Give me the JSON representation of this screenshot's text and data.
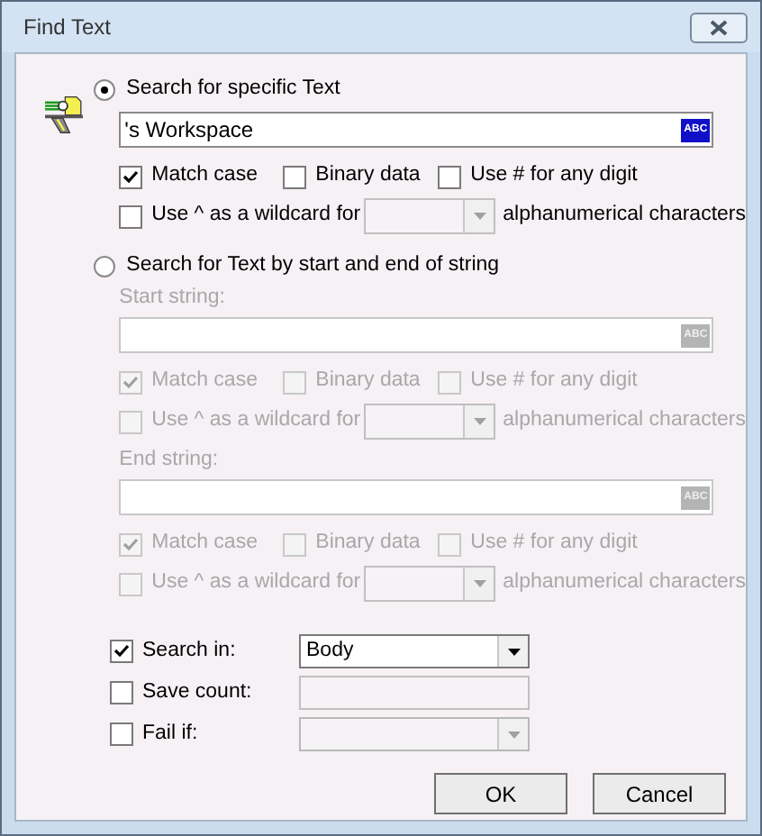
{
  "window": {
    "title": "Find Text"
  },
  "search_specific": {
    "label": "Search for specific Text",
    "selected": true,
    "field": {
      "value": "'s Workspace",
      "button": "ABC",
      "disabled": false
    },
    "options": [
      {
        "label": "Match case",
        "checked": true,
        "disabled": false
      },
      {
        "label": "Binary data",
        "checked": false,
        "disabled": false
      },
      {
        "label": "Use # for any digit",
        "checked": false,
        "disabled": false
      }
    ],
    "wildcard": {
      "label": "Use ^ as a wildcard for",
      "suffix": "alphanumerical characters",
      "checked": false,
      "disabled": false
    }
  },
  "search_by_range": {
    "label": "Search for Text by start and end of string",
    "selected": false,
    "strings": [
      {
        "label": "Start string:",
        "field": {
          "button": "ABC",
          "disabled": true
        },
        "options": [
          {
            "label": "Match case",
            "checked": true,
            "disabled": true
          },
          {
            "label": "Binary data",
            "checked": false,
            "disabled": true
          },
          {
            "label": "Use # for any digit",
            "checked": false,
            "disabled": true
          }
        ],
        "wildcard": {
          "label": "Use ^ as a wildcard for",
          "suffix": "alphanumerical characters",
          "checked": false,
          "disabled": true
        }
      },
      {
        "label": "End string:",
        "field": {
          "button": "ABC",
          "disabled": true
        },
        "options": [
          {
            "label": "Match case",
            "checked": true,
            "disabled": true
          },
          {
            "label": "Binary data",
            "checked": false,
            "disabled": true
          },
          {
            "label": "Use # for any digit",
            "checked": false,
            "disabled": true
          }
        ],
        "wildcard": {
          "label": "Use ^ as a wildcard for",
          "suffix": "alphanumerical characters",
          "checked": false,
          "disabled": true
        }
      }
    ]
  },
  "settings": [
    {
      "kind": "dropdown",
      "label": "Search in:",
      "checked": true,
      "value": "Body",
      "disabled": false
    },
    {
      "kind": "text",
      "label": "Save count:",
      "checked": false,
      "disabled": true
    },
    {
      "kind": "dropdown",
      "label": "Fail if:",
      "checked": false,
      "disabled": true
    }
  ],
  "buttons": [
    "OK",
    "Cancel"
  ]
}
